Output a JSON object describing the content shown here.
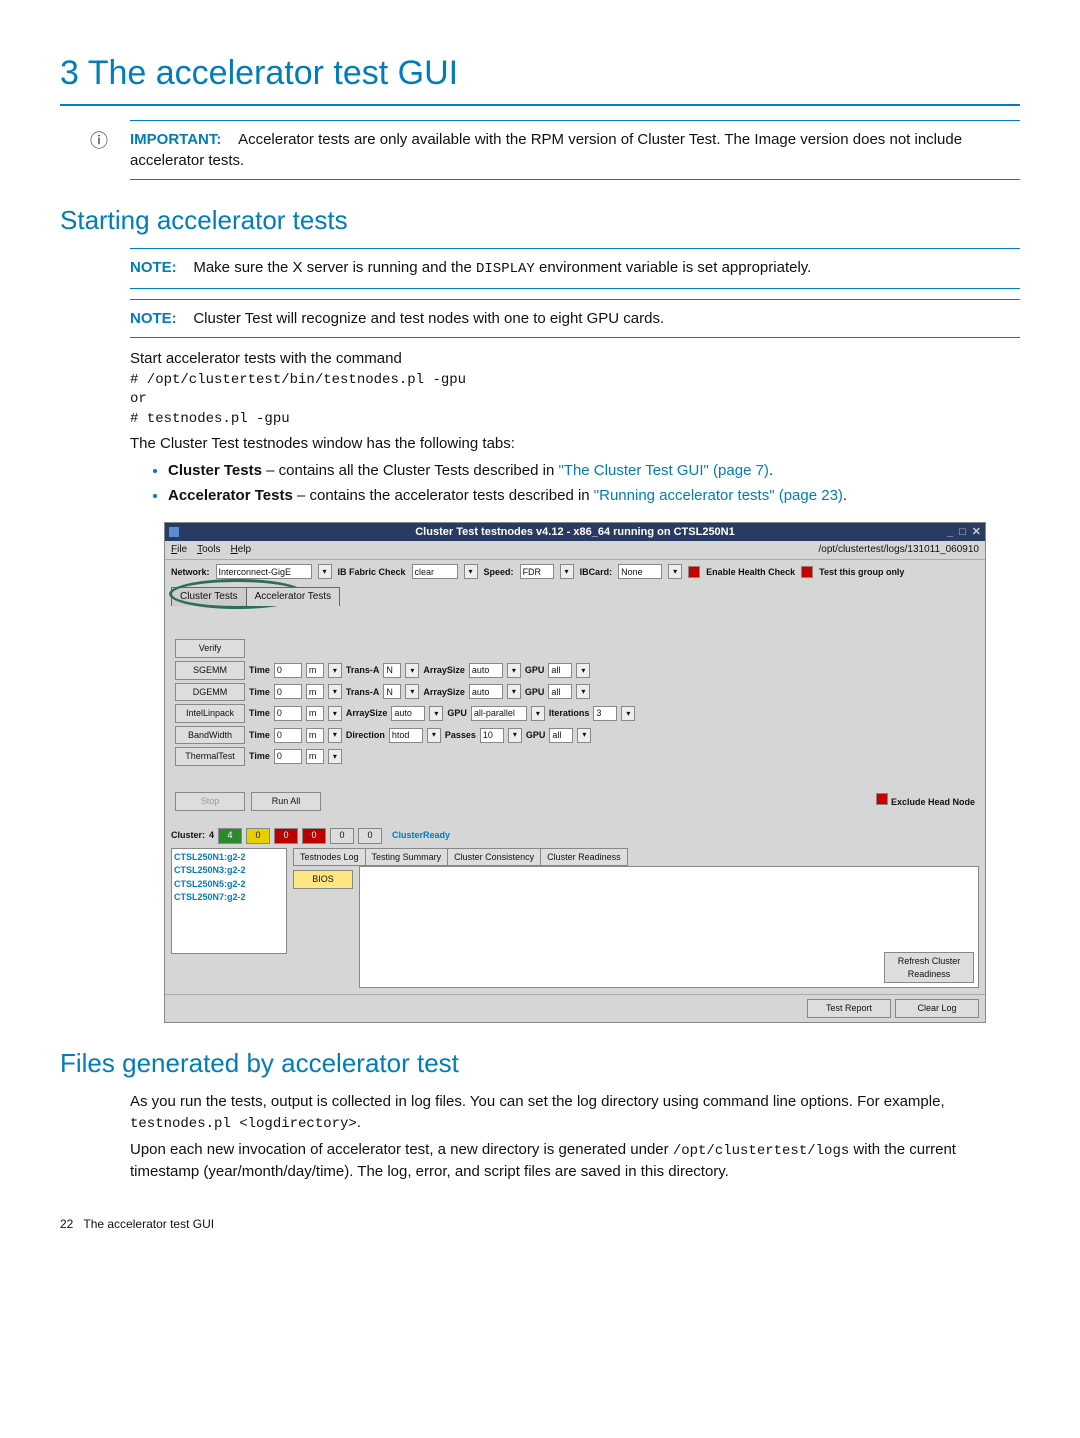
{
  "page": {
    "title": "3 The accelerator test GUI",
    "sec_start": "Starting accelerator tests",
    "sec_files": "Files generated by accelerator test",
    "important_label": "IMPORTANT:",
    "important_text": "Accelerator tests are only available with the RPM version of Cluster Test. The Image version does not include accelerator tests.",
    "note_label": "NOTE:",
    "note1_a": "Make sure the X server is running and the ",
    "note1_code": "DISPLAY",
    "note1_b": " environment variable is set appropriately.",
    "note2": "Cluster Test will recognize and test nodes with one to eight GPU cards.",
    "p_startcmd": "Start accelerator tests with the command",
    "cmd1": "# /opt/clustertest/bin/testnodes.pl -gpu",
    "cmd_or": "or",
    "cmd2": "# testnodes.pl -gpu",
    "p_tabs": "The Cluster Test testnodes window has the following tabs:",
    "bullet1_a": "Cluster Tests",
    "bullet1_b": " – contains all the Cluster Tests described in ",
    "bullet1_link": "\"The Cluster Test GUI\" (page 7)",
    "bullet1_c": ".",
    "bullet2_a": "Accelerator Tests",
    "bullet2_b": " – contains the accelerator tests described in ",
    "bullet2_link": "\"Running accelerator tests\" (page 23)",
    "bullet2_c": ".",
    "files_p1_a": "As you run the tests, output is collected in log files. You can set the log directory using command line options. For example, ",
    "files_p1_code": "testnodes.pl <logdirectory>",
    "files_p1_b": ".",
    "files_p2_a": "Upon each new invocation of accelerator test, a new directory is generated under ",
    "files_p2_code1": "/opt/clustertest/logs",
    "files_p2_b": " with the current timestamp (year/month/day/time). The log, error, and script files are saved in this directory.",
    "footer_page": "22",
    "footer_text": "The accelerator test GUI"
  },
  "win": {
    "title": "Cluster Test testnodes v4.12  -  x86_64 running on CTSL250N1",
    "menu_file": "File",
    "menu_tools": "Tools",
    "menu_help": "Help",
    "logpath": "/opt/clustertest/logs/131011_060910",
    "network_lbl": "Network:",
    "network_val": "Interconnect-GigE",
    "ibfabric_lbl": "IB Fabric Check",
    "ibfabric_val": "clear",
    "speed_lbl": "Speed:",
    "speed_val": "FDR",
    "ibcard_lbl": "IBCard:",
    "ibcard_val": "None",
    "chk1": "Enable Health Check",
    "chk2": "Test this group only",
    "tab_cluster": "Cluster Tests",
    "tab_accel": "Accelerator Tests",
    "tests": {
      "verify": "Verify",
      "sgemm": "SGEMM",
      "dgemm": "DGEMM",
      "intel": "IntelLinpack",
      "band": "BandWidth",
      "therm": "ThermalTest"
    },
    "f": {
      "time": "Time",
      "time_v": "0",
      "m": "m",
      "transa": "Trans-A",
      "transa_v": "N",
      "arrsize": "ArraySize",
      "arrsize_v": "auto",
      "gpu": "GPU",
      "gpu_v": "all",
      "gpu_v2": "all-parallel",
      "iter": "Iterations",
      "iter_v": "3",
      "dir": "Direction",
      "dir_v": "htod",
      "pass": "Passes",
      "pass_v": "10"
    },
    "stop": "Stop",
    "runall": "Run All",
    "exclude": "Exclude Head Node",
    "cluster_lbl": "Cluster:",
    "cluster_n": "4",
    "cready": "ClusterReady",
    "nodes": [
      "CTSL250N1:g2-2",
      "CTSL250N3:g2-2",
      "CTSL250N5:g2-2",
      "CTSL250N7:g2-2"
    ],
    "sub": {
      "log": "Testnodes Log",
      "sum": "Testing Summary",
      "cons": "Cluster Consistency",
      "read": "Cluster Readiness"
    },
    "bios": "BIOS",
    "refresh": "Refresh Cluster Readiness",
    "testreport": "Test Report",
    "clearlog": "Clear Log"
  }
}
